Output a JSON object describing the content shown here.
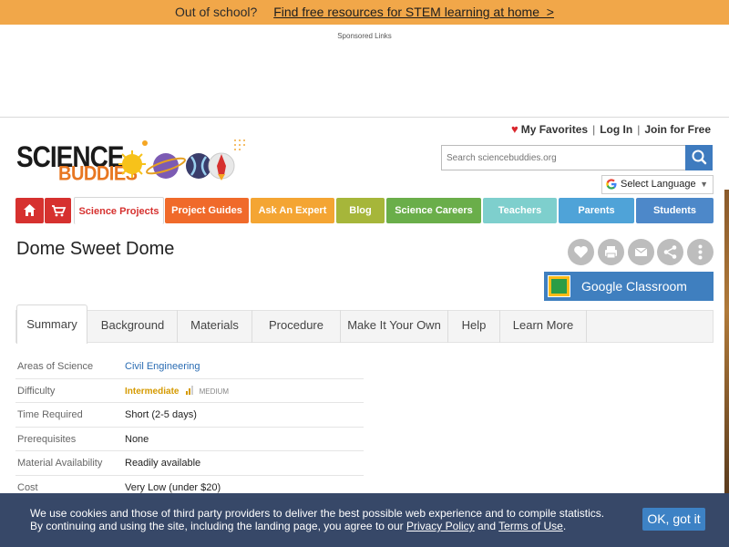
{
  "promo": {
    "lead": "Out of school?",
    "link": "Find free resources for STEM learning at home"
  },
  "sponsored_label": "Sponsored Links",
  "account": {
    "favorites": "My Favorites",
    "login": "Log In",
    "join": "Join for Free"
  },
  "logo": {
    "word1": "SCIENCE",
    "word2": "BUDDIES"
  },
  "search": {
    "placeholder": "Search sciencebuddies.org",
    "icon": "search-icon"
  },
  "language": {
    "label": "Select Language"
  },
  "nav": [
    {
      "label": "",
      "icon": "home-icon",
      "color": "#d6312f"
    },
    {
      "label": "",
      "icon": "cart-icon",
      "color": "#d6312f"
    },
    {
      "label": "Science Projects",
      "color": "#d6312f"
    },
    {
      "label": "Project Guides",
      "color": "#f06a2a"
    },
    {
      "label": "Ask An Expert",
      "color": "#f4a533"
    },
    {
      "label": "Blog",
      "color": "#a6b63a"
    },
    {
      "label": "Science Careers",
      "color": "#6aae4a"
    },
    {
      "label": "Teachers",
      "color": "#7ecfcd"
    },
    {
      "label": "Parents",
      "color": "#4fa3d8"
    },
    {
      "label": "Students",
      "color": "#4d88c9"
    }
  ],
  "page": {
    "title": "Dome Sweet Dome"
  },
  "actions": [
    "heart-icon",
    "print-icon",
    "email-icon",
    "share-icon",
    "more-icon"
  ],
  "classroom": {
    "label": "Google Classroom"
  },
  "tabs": [
    "Summary",
    "Background",
    "Materials",
    "Procedure",
    "Make It Your Own",
    "Help",
    "Learn More"
  ],
  "summary": {
    "areas_label": "Areas of Science",
    "areas_value": "Civil Engineering",
    "difficulty_label": "Difficulty",
    "difficulty_value": "Intermediate",
    "difficulty_sub": "MEDIUM",
    "time_label": "Time Required",
    "time_value": "Short (2-5 days)",
    "prereq_label": "Prerequisites",
    "prereq_value": "None",
    "material_label": "Material Availability",
    "material_value": "Readily available",
    "cost_label": "Cost",
    "cost_value": "Very Low (under $20)"
  },
  "cookie": {
    "line1": "We use cookies and those of third party providers to deliver the best possible web experience and to compile statistics.",
    "line2_pre": "By continuing and using the site, including the landing page, you agree to our ",
    "privacy": "Privacy Policy",
    "and": " and ",
    "terms": "Terms of Use",
    "end": ".",
    "ok": "OK, got it"
  }
}
